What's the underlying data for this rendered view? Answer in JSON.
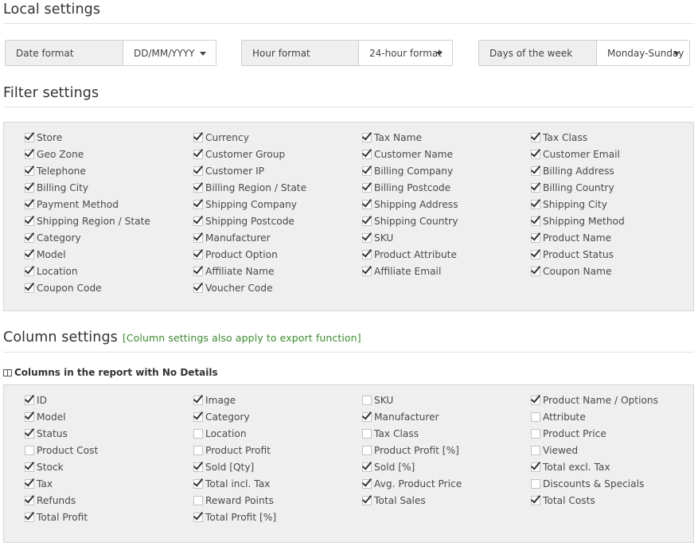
{
  "local": {
    "title": "Local settings",
    "date_label": "Date format",
    "date_value": "DD/MM/YYYY",
    "hour_label": "Hour format",
    "hour_value": "24-hour format",
    "days_label": "Days of the week",
    "days_value": "Monday-Sunday"
  },
  "filter": {
    "title": "Filter settings",
    "items": [
      {
        "label": "Store",
        "checked": true
      },
      {
        "label": "Currency",
        "checked": true
      },
      {
        "label": "Tax Name",
        "checked": true
      },
      {
        "label": "Tax Class",
        "checked": true
      },
      {
        "label": "Geo Zone",
        "checked": true
      },
      {
        "label": "Customer Group",
        "checked": true
      },
      {
        "label": "Customer Name",
        "checked": true
      },
      {
        "label": "Customer Email",
        "checked": true
      },
      {
        "label": "Telephone",
        "checked": true
      },
      {
        "label": "Customer IP",
        "checked": true
      },
      {
        "label": "Billing Company",
        "checked": true
      },
      {
        "label": "Billing Address",
        "checked": true
      },
      {
        "label": "Billing City",
        "checked": true
      },
      {
        "label": "Billing Region / State",
        "checked": true
      },
      {
        "label": "Billing Postcode",
        "checked": true
      },
      {
        "label": "Billing Country",
        "checked": true
      },
      {
        "label": "Payment Method",
        "checked": true
      },
      {
        "label": "Shipping Company",
        "checked": true
      },
      {
        "label": "Shipping Address",
        "checked": true
      },
      {
        "label": "Shipping City",
        "checked": true
      },
      {
        "label": "Shipping Region / State",
        "checked": true
      },
      {
        "label": "Shipping Postcode",
        "checked": true
      },
      {
        "label": "Shipping Country",
        "checked": true
      },
      {
        "label": "Shipping Method",
        "checked": true
      },
      {
        "label": "Category",
        "checked": true
      },
      {
        "label": "Manufacturer",
        "checked": true
      },
      {
        "label": "SKU",
        "checked": true
      },
      {
        "label": "Product Name",
        "checked": true
      },
      {
        "label": "Model",
        "checked": true
      },
      {
        "label": "Product Option",
        "checked": true
      },
      {
        "label": "Product Attribute",
        "checked": true
      },
      {
        "label": "Product Status",
        "checked": true
      },
      {
        "label": "Location",
        "checked": true
      },
      {
        "label": "Affiliate Name",
        "checked": true
      },
      {
        "label": "Affiliate Email",
        "checked": true
      },
      {
        "label": "Coupon Name",
        "checked": true
      },
      {
        "label": "Coupon Code",
        "checked": true
      },
      {
        "label": "Voucher Code",
        "checked": true
      }
    ]
  },
  "columns": {
    "title": "Column settings",
    "note": "[Column settings also apply to export function]",
    "subheading": "Columns in the report with No Details",
    "items": [
      {
        "label": "ID",
        "checked": true
      },
      {
        "label": "Image",
        "checked": true
      },
      {
        "label": "SKU",
        "checked": false
      },
      {
        "label": "Product Name / Options",
        "checked": true
      },
      {
        "label": "Model",
        "checked": true
      },
      {
        "label": "Category",
        "checked": true
      },
      {
        "label": "Manufacturer",
        "checked": true
      },
      {
        "label": "Attribute",
        "checked": false
      },
      {
        "label": "Status",
        "checked": true
      },
      {
        "label": "Location",
        "checked": false
      },
      {
        "label": "Tax Class",
        "checked": false
      },
      {
        "label": "Product Price",
        "checked": false
      },
      {
        "label": "Product Cost",
        "checked": false
      },
      {
        "label": "Product Profit",
        "checked": false
      },
      {
        "label": "Product Profit [%]",
        "checked": false
      },
      {
        "label": "Viewed",
        "checked": false
      },
      {
        "label": "Stock",
        "checked": true
      },
      {
        "label": "Sold [Qty]",
        "checked": true
      },
      {
        "label": "Sold [%]",
        "checked": true
      },
      {
        "label": "Total excl. Tax",
        "checked": true
      },
      {
        "label": "Tax",
        "checked": true
      },
      {
        "label": "Total incl. Tax",
        "checked": true
      },
      {
        "label": "Avg. Product Price",
        "checked": true
      },
      {
        "label": "Discounts & Specials",
        "checked": false
      },
      {
        "label": "Refunds",
        "checked": true
      },
      {
        "label": "Reward Points",
        "checked": false
      },
      {
        "label": "Total Sales",
        "checked": true
      },
      {
        "label": "Total Costs",
        "checked": true
      },
      {
        "label": "Total Profit",
        "checked": true
      },
      {
        "label": "Total Profit [%]",
        "checked": true
      }
    ]
  }
}
